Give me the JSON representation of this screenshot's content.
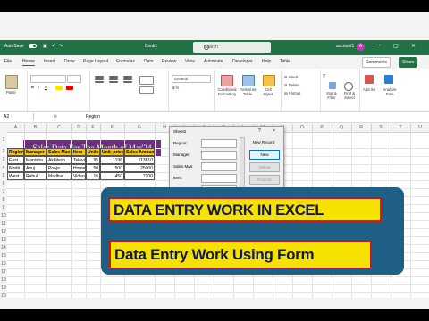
{
  "titlebar": {
    "autosave": "AutoSave",
    "filename": "Book1",
    "search_placeholder": "Search",
    "account": "account1",
    "avatar": "A"
  },
  "menu": {
    "tabs": [
      "File",
      "Home",
      "Insert",
      "Draw",
      "Page Layout",
      "Formulas",
      "Data",
      "Review",
      "View",
      "Automate",
      "Developer",
      "Help",
      "Table"
    ],
    "comments": "Comments",
    "share": "Share"
  },
  "ribbon": {
    "groups": [
      "Clipboard",
      "Font",
      "Alignment",
      "Number",
      "Styles",
      "Cells",
      "Editing",
      "Add-ins"
    ],
    "paste": "Paste",
    "number_format": "General",
    "conditional": "Conditional Formatting",
    "format_table": "Format as Table",
    "cell_styles": "Cell Styles",
    "insert": "Insert",
    "delete": "Delete",
    "format": "Format",
    "sort": "Sort & Filter",
    "find": "Find & Select",
    "addins": "Add-ins",
    "analyze": "Analyze Data"
  },
  "formula_bar": {
    "name_box": "A2",
    "fx": "fx",
    "value": "Region"
  },
  "sheet": {
    "columns": [
      "A",
      "B",
      "C",
      "D",
      "E",
      "F",
      "G",
      "H",
      "I",
      "J",
      "K",
      "L",
      "M",
      "N",
      "O",
      "P",
      "Q",
      "R",
      "S",
      "T",
      "U",
      "V"
    ],
    "rows": [
      "1",
      "2",
      "3",
      "4",
      "5",
      "6",
      "7",
      "8",
      "9",
      "10",
      "11",
      "12",
      "13",
      "14",
      "15",
      "16",
      "17",
      "18",
      "19",
      "20"
    ],
    "title": "Sales Data For The Month of Mar'24",
    "headers": [
      "Region",
      "Manager",
      "Sales Man",
      "Item",
      "Units",
      "Unit_price",
      "Sales Amount"
    ],
    "data": [
      [
        "East",
        "Manisha",
        "Akhilesh",
        "Televi",
        "95",
        "1198",
        "113810"
      ],
      [
        "North",
        "Anuj",
        "Pooja",
        "Home",
        "50",
        "500",
        "25000"
      ],
      [
        "West",
        "Rahul",
        "Madhur",
        "Video",
        "16",
        "450",
        "7200"
      ]
    ]
  },
  "dialog": {
    "title": "Sheet2",
    "help": "?",
    "close": "×",
    "fields": [
      "Region:",
      "Manager:",
      "Sales Man:",
      "Item:",
      "Units:"
    ],
    "new_record": "New Record",
    "buttons": [
      "New",
      "Delete",
      "Restore"
    ]
  },
  "overlay": {
    "line1": "DATA ENTRY WORK IN EXCEL",
    "line2": "Data Entry Work Using Form"
  },
  "colors": {
    "excel_green": "#217346",
    "title_purple": "#6f2f7f",
    "header_gold": "#ffc000",
    "banner_yellow": "#f6e200",
    "banner_red": "#c21a1a",
    "overlay_blue": "#1f5f86"
  }
}
